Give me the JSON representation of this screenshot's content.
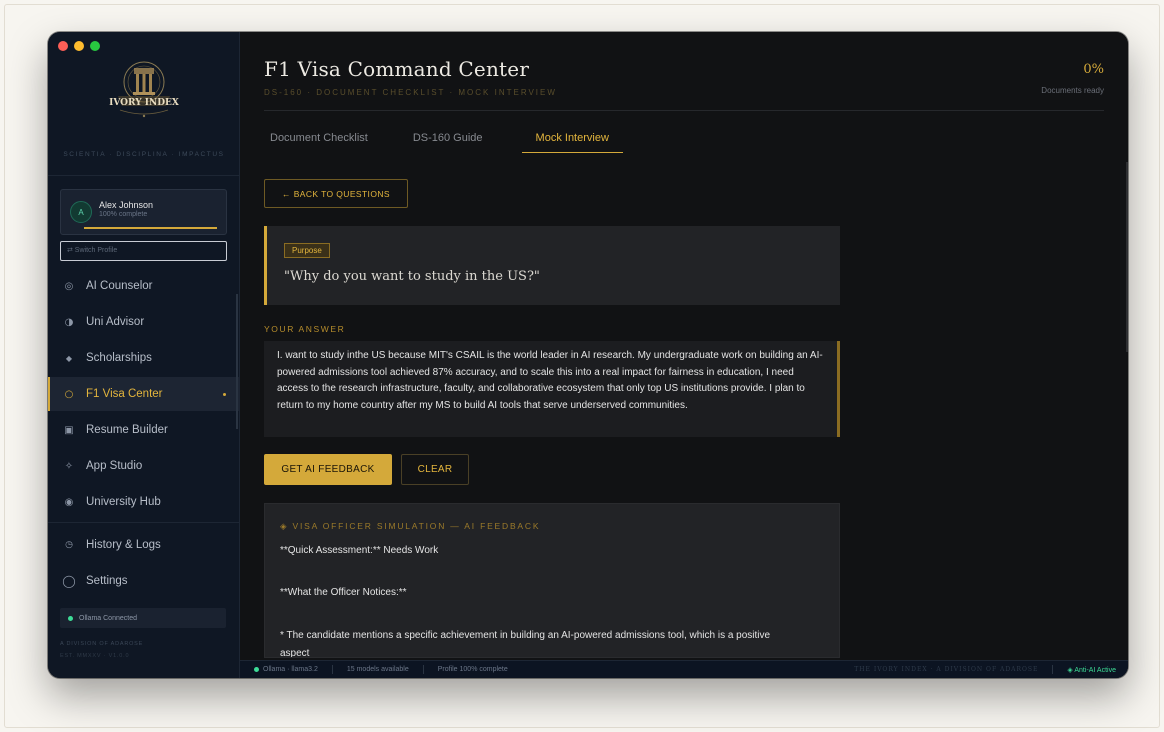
{
  "app": {
    "logo_text": "IVORY INDEX",
    "motto": "SCIENTIA · DISCIPLINA · IMPACTUS"
  },
  "profile": {
    "initial": "A",
    "name": "Alex Johnson",
    "status": "100% complete",
    "progress_fraction": 1.0,
    "switch_label": "⇄  Switch Profile"
  },
  "sidebar": {
    "items": [
      {
        "label": "AI Counselor",
        "icon": "target-icon"
      },
      {
        "label": "Uni Advisor",
        "icon": "half-circle-icon"
      },
      {
        "label": "Scholarships",
        "icon": "diamond-icon"
      },
      {
        "label": "F1 Visa Center",
        "icon": "ring-icon",
        "active": true
      },
      {
        "label": "Resume Builder",
        "icon": "square-icon"
      },
      {
        "label": "App Studio",
        "icon": "sparkle-icon"
      },
      {
        "label": "University Hub",
        "icon": "filled-circle-icon"
      },
      {
        "label": "History & Logs",
        "icon": "clock-icon"
      },
      {
        "label": "Settings",
        "icon": "circle-icon"
      }
    ],
    "ollama_status": "Ollama Connected",
    "division": "A DIVISION OF ADAROSE",
    "est": "EST. MMXXV · V1.0.0"
  },
  "header": {
    "title": "F1 Visa Command Center",
    "subtitle": "DS-160 · DOCUMENT CHECKLIST · MOCK INTERVIEW",
    "percent": "0%",
    "percent_label": "Documents ready"
  },
  "tabs": [
    "Document Checklist",
    "DS-160 Guide",
    "Mock Interview"
  ],
  "active_tab": "Mock Interview",
  "back_button": "← BACK TO QUESTIONS",
  "question": {
    "category": "Purpose",
    "text": "\"Why do you want to study in the US?\""
  },
  "answer": {
    "label": "YOUR ANSWER",
    "text": "I. want to study inthe US because MIT's CSAIL is the world leader in AI research. My undergraduate work on building an AI-powered admissions tool achieved 87% accuracy, and to scale this into a real impact for fairness in education, I need access to the research infrastructure, faculty, and collaborative ecosystem that only top US institutions provide. I plan to return to my home country after my MS to build AI tools that serve underserved communities."
  },
  "buttons": {
    "feedback": "GET AI FEEDBACK",
    "clear": "CLEAR"
  },
  "feedback": {
    "title": "◈ VISA OFFICER SIMULATION — AI FEEDBACK",
    "lines": [
      "**Quick Assessment:** Needs Work",
      "**What the Officer Notices:**",
      "* The candidate mentions a specific achievement in building an AI-powered admissions tool, which is a positive",
      "aspect"
    ]
  },
  "statusbar": {
    "model": "Ollama · llama3.2",
    "models": "15 models available",
    "profile": "Profile 100% complete",
    "brand": "THE IVORY INDEX · A DIVISION OF ADAROSE",
    "anti_ai": "◈ Anti-AI Active"
  },
  "colors": {
    "accent": "#d4a93a",
    "sidebar_bg": "#0f1724",
    "main_bg": "#111214",
    "status_green": "#3ddc97"
  }
}
